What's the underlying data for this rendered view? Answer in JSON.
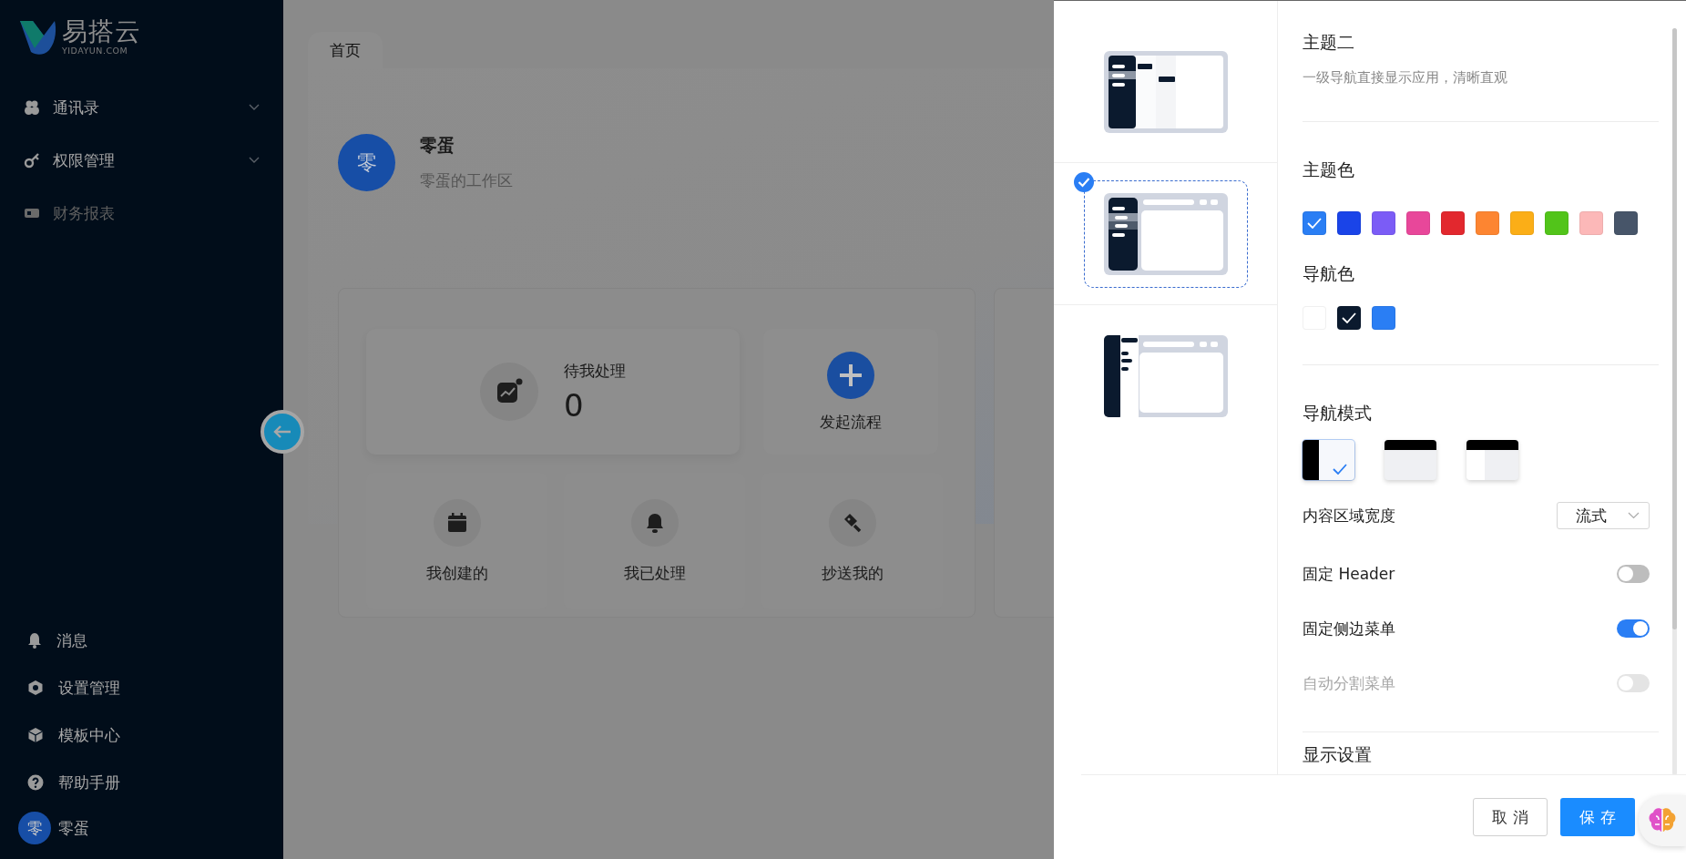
{
  "sidebar": {
    "logo": {
      "name": "易搭云",
      "domain": "YIDAYUN.COM"
    },
    "menu": [
      {
        "label": "通讯录",
        "expandable": true,
        "disabled": false
      },
      {
        "label": "权限管理",
        "expandable": true,
        "disabled": false
      },
      {
        "label": "财务报表",
        "expandable": false,
        "disabled": true
      }
    ],
    "bottom_items": [
      {
        "label": "消息"
      },
      {
        "label": "设置管理"
      },
      {
        "label": "模板中心"
      },
      {
        "label": "帮助手册"
      }
    ],
    "user": {
      "avatar": "零",
      "name": "零蛋"
    }
  },
  "main": {
    "tabs": [
      {
        "label": "首页",
        "selected": true
      }
    ],
    "workspace": {
      "avatar": "零",
      "name": "零蛋",
      "subtitle": "零蛋的工作区"
    },
    "pending": {
      "label": "待我处理",
      "count": "0"
    },
    "start": {
      "label": "发起流程"
    },
    "shortcuts": [
      {
        "label": "我创建的"
      },
      {
        "label": "我已处理"
      },
      {
        "label": "抄送我的"
      }
    ]
  },
  "drawer": {
    "layouts": [
      {
        "selected": false
      },
      {
        "selected": true
      },
      {
        "selected": false
      }
    ],
    "theme": {
      "title": "主题二",
      "description": "一级导航直接显示应用，清晰直观"
    },
    "theme_colors": {
      "label": "主题色",
      "swatches": [
        {
          "color": "#2a7ef4",
          "selected": true
        },
        {
          "color": "#1a44e8",
          "selected": false
        },
        {
          "color": "#7b5cf6",
          "selected": false
        },
        {
          "color": "#e8479a",
          "selected": false
        },
        {
          "color": "#e2282e",
          "selected": false
        },
        {
          "color": "#fd8531",
          "selected": false
        },
        {
          "color": "#fbae17",
          "selected": false
        },
        {
          "color": "#52c41a",
          "selected": false
        },
        {
          "color": "#fcb8b8",
          "selected": false
        },
        {
          "color": "#475569",
          "selected": false
        }
      ]
    },
    "nav_colors": {
      "label": "导航色",
      "swatches": [
        {
          "color": "#ffffff",
          "selected": false
        },
        {
          "color": "#0b1a2e",
          "selected": true
        },
        {
          "color": "#2a7ef4",
          "selected": false
        }
      ]
    },
    "nav_mode": {
      "label": "导航模式",
      "options": [
        {
          "selected": true
        },
        {
          "selected": false
        },
        {
          "selected": false
        }
      ]
    },
    "content_width": {
      "label": "内容区域宽度",
      "value": "流式"
    },
    "switches": [
      {
        "label": "固定 Header",
        "on": false,
        "disabled": false
      },
      {
        "label": "固定侧边菜单",
        "on": true,
        "disabled": false
      },
      {
        "label": "自动分割菜单",
        "on": false,
        "disabled": true
      }
    ],
    "display_settings": {
      "label": "显示设置"
    },
    "buttons": {
      "cancel": "取 消",
      "save": "保 存"
    }
  }
}
